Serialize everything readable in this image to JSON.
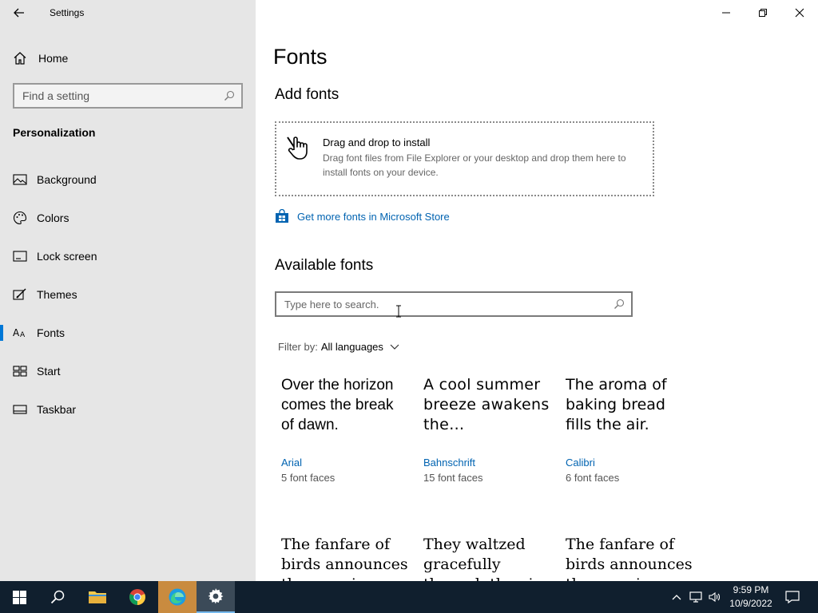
{
  "window": {
    "title": "Settings"
  },
  "sidebar": {
    "home_label": "Home",
    "search_placeholder": "Find a setting",
    "section_title": "Personalization",
    "items": [
      {
        "label": "Background",
        "icon": "picture-icon",
        "selected": false
      },
      {
        "label": "Colors",
        "icon": "palette-icon",
        "selected": false
      },
      {
        "label": "Lock screen",
        "icon": "lock-screen-icon",
        "selected": false
      },
      {
        "label": "Themes",
        "icon": "themes-brush-icon",
        "selected": false
      },
      {
        "label": "Fonts",
        "icon": "fonts-icon",
        "selected": true
      },
      {
        "label": "Start",
        "icon": "start-icon",
        "selected": false
      },
      {
        "label": "Taskbar",
        "icon": "taskbar-icon",
        "selected": false
      }
    ]
  },
  "main": {
    "page_title": "Fonts",
    "add_fonts_heading": "Add fonts",
    "dropzone": {
      "title": "Drag and drop to install",
      "description": "Drag font files from File Explorer or your desktop and drop them here to install fonts on your device."
    },
    "store_link": "Get more fonts in Microsoft Store",
    "available_heading": "Available fonts",
    "search_placeholder": "Type here to search.",
    "filter_label": "Filter by:",
    "filter_value": "All languages",
    "fonts": [
      {
        "sample": "Over the horizon comes the break of dawn.",
        "name": "Arial",
        "faces": "5 font faces"
      },
      {
        "sample": "A cool summer breeze awakens the…",
        "name": "Bahnschrift",
        "faces": "15 font faces"
      },
      {
        "sample": "The aroma of baking bread fills the air.",
        "name": "Calibri",
        "faces": "6 font faces"
      },
      {
        "sample": "The fanfare of birds announces the morning.",
        "name": "",
        "faces": ""
      },
      {
        "sample": "They waltzed gracefully through the air.",
        "name": "",
        "faces": ""
      },
      {
        "sample": "The fanfare of birds announces the morning.",
        "name": "",
        "faces": ""
      }
    ]
  },
  "taskbar": {
    "apps": [
      "start-icon",
      "search-icon",
      "file-explorer-icon",
      "chrome-icon",
      "edge-icon",
      "settings-icon"
    ],
    "active_app": "settings-icon",
    "time": "9:59 PM",
    "date": "10/9/2022"
  },
  "colors": {
    "accent": "#0078d7",
    "link": "#0063b1",
    "sidebar_bg": "#e6e6e6",
    "taskbar_bg": "#101f2e"
  }
}
